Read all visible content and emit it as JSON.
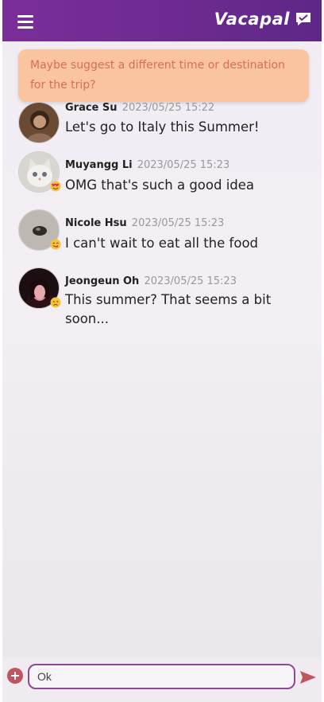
{
  "app": {
    "title": "Vacapal"
  },
  "suggestion": {
    "text": "Maybe suggest a different time or destination for the trip?"
  },
  "messages": [
    {
      "name": "Grace Su",
      "time": "2023/05/25 15:22",
      "text": "Let's go to Italy this Summer!",
      "emoji": "none"
    },
    {
      "name": "Muyangg Li",
      "time": "2023/05/25 15:23",
      "text": "OMG that's such a good idea",
      "emoji": "heart-eyes"
    },
    {
      "name": "Nicole Hsu",
      "time": "2023/05/25 15:23",
      "text": "I can't wait to eat all the food",
      "emoji": "yum"
    },
    {
      "name": "Jeongeun Oh",
      "time": "2023/05/25 15:23",
      "text": "This summer? That seems a bit soon...",
      "emoji": "worried"
    }
  ],
  "composer": {
    "value": "Ok"
  },
  "colors": {
    "header": "#6c2a8f",
    "suggestion_bg": "#f9c49e",
    "suggestion_text": "#d56f5a",
    "input_border": "#8c4a94",
    "send": "#c05560"
  }
}
